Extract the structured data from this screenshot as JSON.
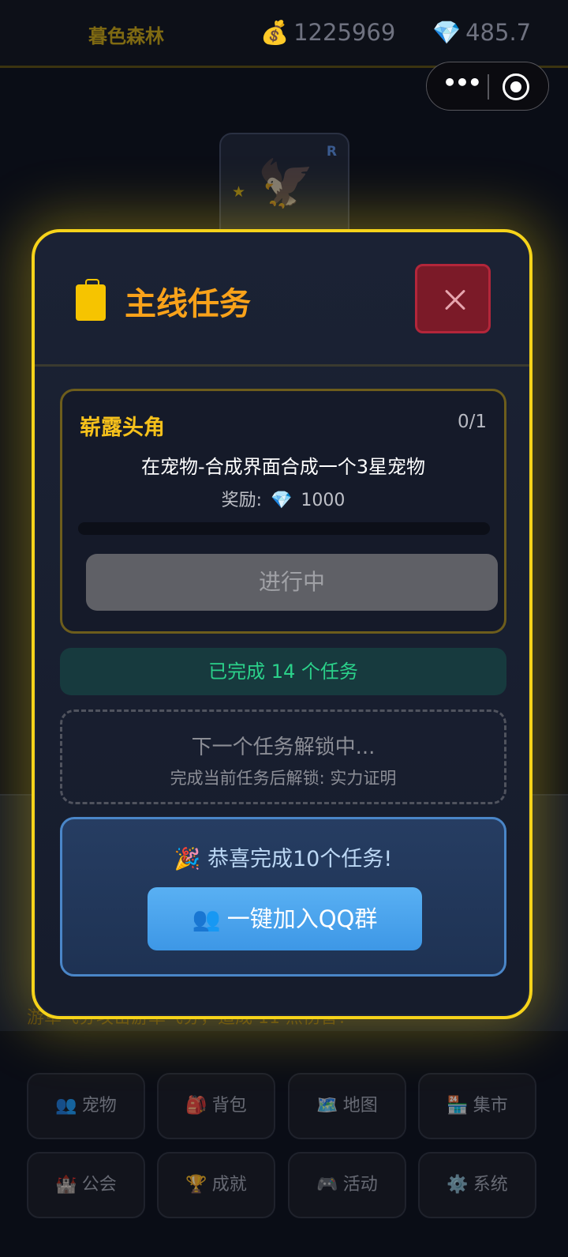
{
  "topbar": {
    "title": "暮色森林",
    "gold_icon": "money-bag-icon",
    "gold": "1225969",
    "gem_icon": "diamond-icon",
    "gems": "485.7"
  },
  "capsule": {
    "more_label": "•••"
  },
  "pet_card": {
    "rank": "R",
    "star": "★",
    "portrait": "🦅"
  },
  "background": {
    "caption": "游草飞券攻击游草飞券，造成 11 点伤害！"
  },
  "nav": [
    {
      "icon": "👥",
      "label": "宠物"
    },
    {
      "icon": "🎒",
      "label": "背包"
    },
    {
      "icon": "🗺️",
      "label": "地图"
    },
    {
      "icon": "🏪",
      "label": "集市"
    },
    {
      "icon": "🏰",
      "label": "公会"
    },
    {
      "icon": "🏆",
      "label": "成就"
    },
    {
      "icon": "🎮",
      "label": "活动"
    },
    {
      "icon": "⚙️",
      "label": "系统"
    }
  ],
  "modal": {
    "title": "主线任务",
    "task": {
      "name": "崭露头角",
      "count": "0/1",
      "description": "在宠物-合成界面合成一个3星宠物",
      "reward_label": "奖励:",
      "reward_icon": "💎",
      "reward_amount": "1000",
      "progress": 0,
      "status": "进行中"
    },
    "completed_text": "已完成 14 个任务",
    "locked": {
      "title": "下一个任务解锁中...",
      "subtitle": "完成当前任务后解锁: 实力证明"
    },
    "reward_card": {
      "title": "🎉 恭喜完成10个任务!",
      "button_icon": "👥",
      "button_label": "一键加入QQ群"
    }
  },
  "colors": {
    "modal_border": "#f6d31a",
    "title": "#f9a21a",
    "task_name": "#f6c11b",
    "completed": "#2bd18a",
    "close_button": "#7b1a28",
    "qq_button": "#4aa3ee"
  }
}
